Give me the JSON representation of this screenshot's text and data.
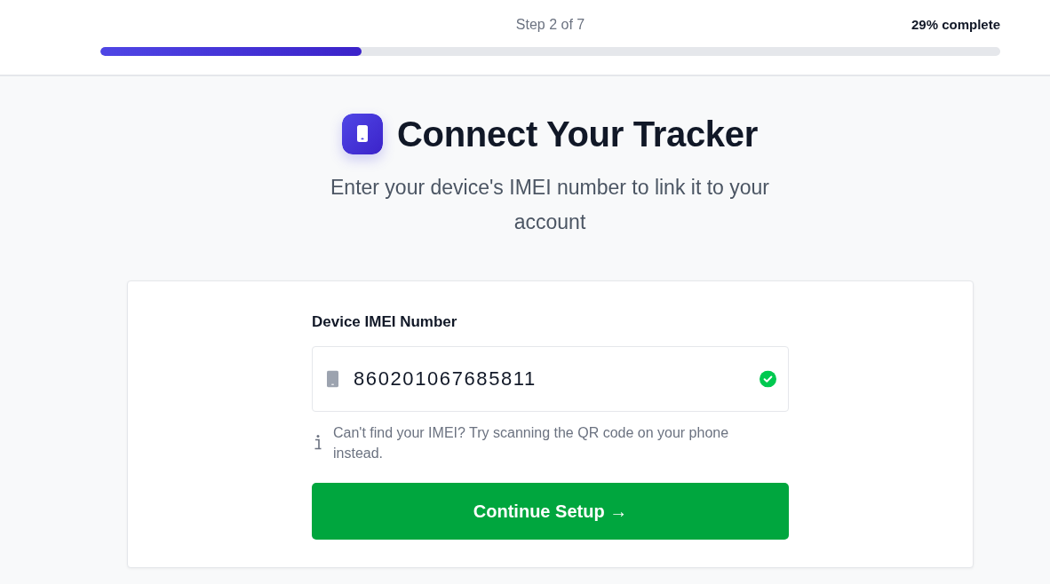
{
  "header": {
    "step": "Step 2 of 7",
    "percent": "29% complete",
    "progress": {
      "level": 0.29
    }
  },
  "hero": {
    "title": "Connect Your Tracker",
    "subtitle": "Enter your device's IMEI number to link it to your account"
  },
  "form": {
    "label": "Device IMEI Number",
    "imei": {
      "value": "860201067685811",
      "valid": true
    },
    "help": "Can't find your IMEI? Try scanning the QR code on your phone instead.",
    "button": "Continue Setup →"
  }
}
